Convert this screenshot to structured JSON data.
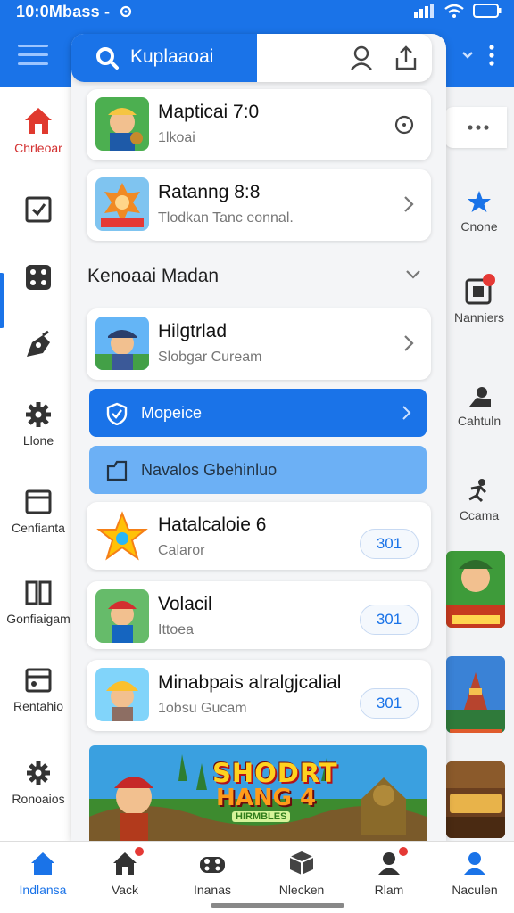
{
  "status": {
    "time": "10:0Mbass -",
    "time_icon": "location-icon"
  },
  "search": {
    "query": "Kuplaaoai"
  },
  "left_rail": [
    {
      "label": "Chrleoar",
      "icon": "home-icon"
    },
    {
      "label": "",
      "icon": "checkbox-icon"
    },
    {
      "label": "",
      "icon": "dice-icon"
    },
    {
      "label": "",
      "icon": "pen-icon"
    },
    {
      "label": "Llone",
      "icon": "gear-icon"
    },
    {
      "label": "Cenfianta",
      "icon": "window-icon"
    },
    {
      "label": "Gonfiaigam",
      "icon": "columns-icon"
    },
    {
      "label": "Rentahio",
      "icon": "calendar-icon"
    },
    {
      "label": "Ronoaios",
      "icon": "settings-icon"
    }
  ],
  "right_rail": [
    {
      "label": "Cnone",
      "icon": "star-icon"
    },
    {
      "label": "Nanniers",
      "icon": "notification-icon"
    },
    {
      "label": "Cahtuln",
      "icon": "person-desk-icon"
    },
    {
      "label": "Ccama",
      "icon": "running-icon"
    }
  ],
  "cards_top": [
    {
      "title": "Mapticai 7:0",
      "sub": "1lkoai",
      "action": "more"
    },
    {
      "title": "Ratanng 8:8",
      "sub": "Tlodkan Tanc eonnal.",
      "action": "chevron"
    }
  ],
  "section": {
    "title": "Kenoaai Madan"
  },
  "card_mid": {
    "title": "Hilgtrlad",
    "sub": "Slobgar Cuream"
  },
  "buttons": {
    "primary": "Mopeice",
    "secondary": "Navalos Gbehinluo"
  },
  "cards_bottom": [
    {
      "title": "Hatalcaloie 6",
      "sub": "Calaror",
      "badge": "301"
    },
    {
      "title": "Volacil",
      "sub": "Ittoea",
      "badge": "301"
    },
    {
      "title": "Minabpais alralgjcalial",
      "sub": "1obsu Gucam",
      "badge": "301"
    }
  ],
  "banner": {
    "line1": "SHODRT",
    "line2": "HANG 4",
    "line3": "HIRMBLES"
  },
  "bottom_nav": [
    {
      "label": "Indlansa",
      "icon": "home-icon",
      "active": true
    },
    {
      "label": "Vack",
      "icon": "house-icon",
      "badge": true
    },
    {
      "label": "Inanas",
      "icon": "gamepad-icon"
    },
    {
      "label": "Nlecken",
      "icon": "package-icon"
    },
    {
      "label": "Rlam",
      "icon": "user-icon",
      "badge": true
    },
    {
      "label": "Naculen",
      "icon": "account-icon"
    }
  ],
  "colors": {
    "primary": "#1a73e8",
    "primary_light": "#6cb0f5",
    "badge_red": "#e53935"
  }
}
